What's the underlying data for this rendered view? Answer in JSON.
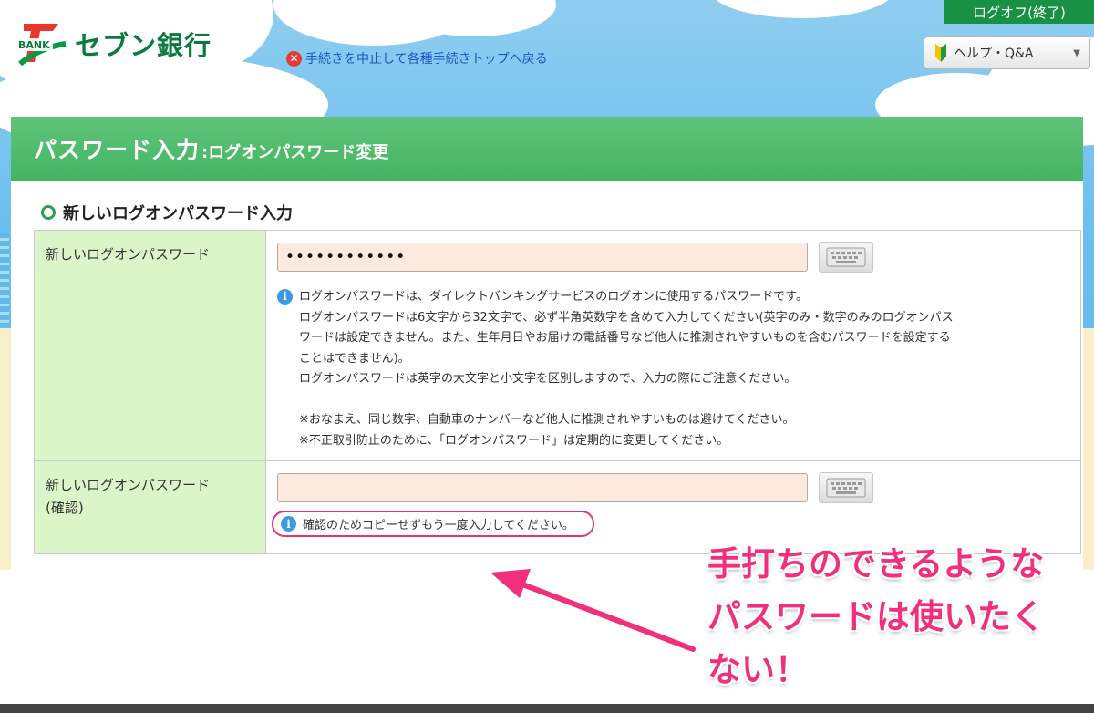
{
  "header": {
    "logo_badge": "BANK",
    "logo_text": "セブン銀行",
    "cancel_link": "手続きを中止して各種手続きトップへ戻る",
    "logout_button": "ログオフ(終了)",
    "help_button": "ヘルプ・Q&A"
  },
  "page": {
    "title_main": "パスワード入力",
    "title_sub": ":ログオンパスワード変更",
    "section_heading": "新しいログオンパスワード入力"
  },
  "form": {
    "row1": {
      "label": "新しいログオンパスワード",
      "value": "••••••••••••",
      "info_lines": [
        "ログオンパスワードは、ダイレクトバンキングサービスのログオンに使用するパスワードです。",
        "ログオンパスワードは6文字から32文字で、必ず半角英数字を含めて入力してください(英字のみ・数字のみのログオンパス",
        "ワードは設定できません。また、生年月日やお届けの電話番号など他人に推測されやすいものを含むパスワードを設定する",
        "ことはできません)。",
        "ログオンパスワードは英字の大文字と小文字を区別しますので、入力の際にご注意ください。",
        "",
        "※おなまえ、同じ数字、自動車のナンバーなど他人に推測されやすいものは避けてください。",
        "※不正取引防止のために、「ログオンパスワード」は定期的に変更してください。"
      ]
    },
    "row2": {
      "label_line1": "新しいログオンパスワード",
      "label_line2": "(確認)",
      "value": "",
      "note": "確認のためコピーせずもう一度入力してください。"
    }
  },
  "annotation": {
    "line1": "手打ちのできるような",
    "line2": "パスワードは使いたく",
    "line3": "ない！",
    "color": "#f0307d"
  },
  "icons": {
    "logo": "seven-bank-logo-icon",
    "cancel": "close-circle-icon",
    "help": "beginner-leaf-icon",
    "keyboard": "keyboard-icon",
    "info": "info-icon"
  }
}
